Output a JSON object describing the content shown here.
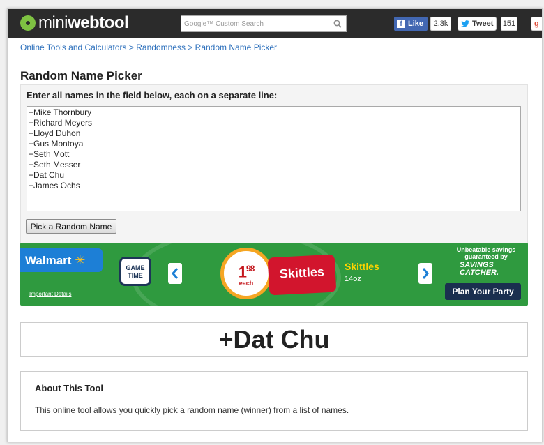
{
  "header": {
    "logo_mini": "mini",
    "logo_webtool": "webtool",
    "search_placeholder": "Google™ Custom Search",
    "fb_like": "Like",
    "fb_count": "2.3k",
    "tweet": "Tweet",
    "tweet_count": "151",
    "gplus": "g"
  },
  "breadcrumb": {
    "items": [
      "Online Tools and Calculators",
      "Randomness",
      "Random Name Picker"
    ],
    "separator": ">"
  },
  "page": {
    "title": "Random Name Picker",
    "instruction": "Enter all names in the field below, each on a separate line:",
    "names": "+Mike Thornbury\n+Richard Meyers\n+Lloyd Duhon\n+Gus Montoya\n+Seth Mott\n+Seth Messer\n+Dat Chu\n+James Ochs",
    "pick_button": "Pick a Random Name",
    "result": "+Dat Chu"
  },
  "ad": {
    "walmart": "Walmart",
    "important": "Important Details",
    "gametime_1": "GAME",
    "gametime_2": "TIME",
    "price_dollars": "1",
    "price_cents": "98",
    "price_each": "each",
    "pack_label": "Skittles",
    "product_name": "Skittles",
    "product_size": "14oz",
    "savings_line": "Unbeatable savings guaranteed by",
    "savings_logo_1": "SAVINGS",
    "savings_logo_2": "CATCHER.",
    "plan_button": "Plan Your Party",
    "colors": {
      "background": "#2f9a3f",
      "walmart_blue": "#1d7fd6",
      "skittles_red": "#d2152d"
    }
  },
  "about": {
    "title": "About This Tool",
    "text": "This online tool allows you quickly pick a random name (winner) from a list of names."
  }
}
